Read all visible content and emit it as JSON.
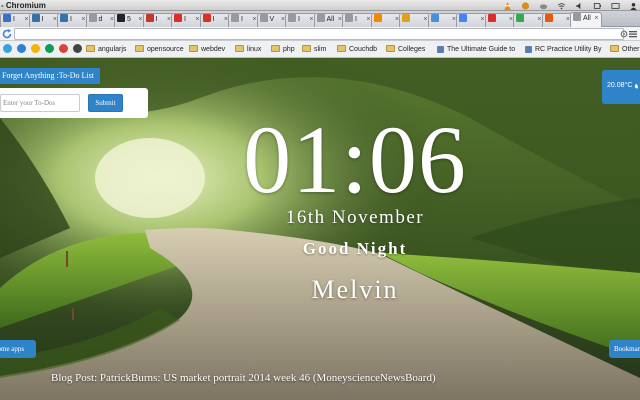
{
  "window": {
    "title": "- Chromium"
  },
  "tabs": [
    {
      "label": "I",
      "favicon": "generic",
      "color": "#3a6fc7"
    },
    {
      "label": "I",
      "favicon": "python",
      "color": "#3572a5"
    },
    {
      "label": "I",
      "favicon": "python",
      "color": "#3572a5"
    },
    {
      "label": "d",
      "favicon": "document",
      "color": "#999999"
    },
    {
      "label": "5",
      "favicon": "dark-square",
      "color": "#222222"
    },
    {
      "label": "I",
      "favicon": "red-square",
      "color": "#c0392b"
    },
    {
      "label": "I",
      "favicon": "red-bookmark",
      "color": "#d93025"
    },
    {
      "label": "I",
      "favicon": "gmail",
      "color": "#d93025"
    },
    {
      "label": "I",
      "favicon": "document",
      "color": "#999999"
    },
    {
      "label": "V",
      "favicon": "document",
      "color": "#999999"
    },
    {
      "label": "I",
      "favicon": "document",
      "color": "#999999"
    },
    {
      "label": "All",
      "favicon": "document",
      "color": "#999999"
    },
    {
      "label": "I",
      "favicon": "document",
      "color": "#999999"
    },
    {
      "label": "",
      "favicon": "vlc",
      "color": "#f08a00"
    },
    {
      "label": "",
      "favicon": "trophy",
      "color": "#e0a020"
    },
    {
      "label": "",
      "favicon": "blue-square",
      "color": "#4a90d9"
    },
    {
      "label": "",
      "favicon": "google",
      "color": "#4285f4"
    },
    {
      "label": "",
      "favicon": "gmail",
      "color": "#d93025"
    },
    {
      "label": "",
      "favicon": "chrome",
      "color": "#34a853"
    },
    {
      "label": "",
      "favicon": "orange-circle",
      "color": "#e8590c"
    },
    {
      "label": "All",
      "favicon": "document",
      "color": "#999999",
      "active": true
    }
  ],
  "addressbar": {
    "url": ""
  },
  "bookmarks_bar": {
    "apps": [
      {
        "name": "chrome-app",
        "color": "#3aa0e0"
      },
      {
        "name": "chrome-app",
        "color": "#2e7dd7"
      },
      {
        "name": "chrome-app",
        "color": "#f4b400"
      },
      {
        "name": "chrome-app",
        "color": "#0f9d58"
      },
      {
        "name": "chrome-app",
        "color": "#db4437"
      },
      {
        "name": "chrome-app",
        "color": "#444444"
      }
    ],
    "items": [
      {
        "label": "angularjs",
        "type": "folder"
      },
      {
        "label": "opensource",
        "type": "folder"
      },
      {
        "label": "webdev",
        "type": "folder"
      },
      {
        "label": "linux",
        "type": "folder"
      },
      {
        "label": "php",
        "type": "folder"
      },
      {
        "label": "slim",
        "type": "folder"
      },
      {
        "label": "Couchdb",
        "type": "folder"
      },
      {
        "label": "Colleges",
        "type": "folder"
      },
      {
        "label": "The Ultimate Guide to",
        "type": "link"
      },
      {
        "label": "RC Practice Utility By",
        "type": "link"
      }
    ],
    "overflow_label": "Other"
  },
  "dashboard": {
    "todo": {
      "tab_label": "Forget Anything :To-Do List",
      "input_placeholder": "Enter your To-Dos",
      "input_value": "",
      "submit_label": "Submit"
    },
    "weather": {
      "temperature": "20.08°C",
      "icon": "cloud-icon"
    },
    "clock": "01:06",
    "date": "16th November",
    "greeting": "Good Night",
    "user_name": "Melvin",
    "apps_button": "Chrome apps",
    "bookmarks_button": "Bookmarks",
    "blog_post": "Blog Post: PatrickBurns: US market portrait 2014 week 46 (MoneyscienceNewsBoard)"
  },
  "colors": {
    "accent": "#2f83c9"
  }
}
